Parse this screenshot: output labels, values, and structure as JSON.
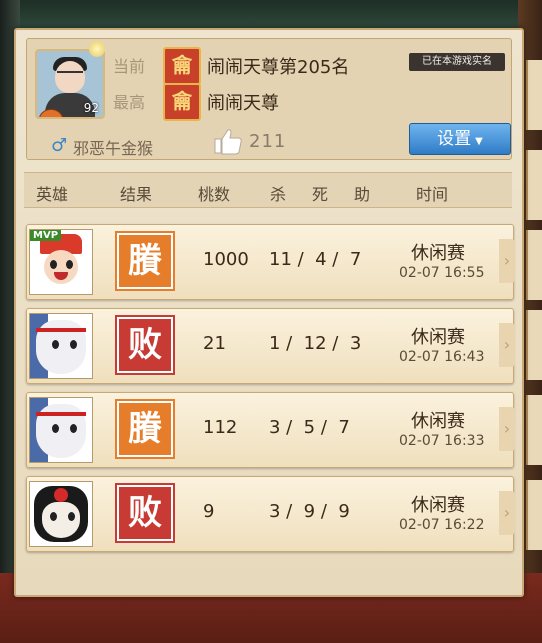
{
  "profile": {
    "level": "92",
    "current_label": "当前",
    "best_label": "最高",
    "rank_icon_glyph": "龠",
    "current_rank": "闹闹天尊第205名",
    "best_rank": "闹闹天尊",
    "realname_badge": "已在本游戏实名",
    "gender_icon": "male-icon",
    "username": "邪恶午金猴",
    "like_icon": "thumb-up-icon",
    "like_count": "211",
    "settings_label": "设置"
  },
  "columns": {
    "hero": "英雄",
    "result": "结果",
    "peach": "桃数",
    "kill": "杀",
    "death": "死",
    "assist": "助",
    "time": "时间"
  },
  "matches": [
    {
      "hero": "red-crown-hero",
      "mvp": "MVP",
      "result": "win",
      "result_glyph": "賸",
      "peach": "1000",
      "kda": "11 /  4 /  7",
      "mode": "休闲赛",
      "time": "02-07 16:55"
    },
    {
      "hero": "white-face-hero",
      "mvp": "",
      "result": "lose",
      "result_glyph": "败",
      "peach": "21",
      "kda": "1 /  12 /  3",
      "mode": "休闲赛",
      "time": "02-07 16:43"
    },
    {
      "hero": "white-face-hero",
      "mvp": "",
      "result": "win",
      "result_glyph": "賸",
      "peach": "112",
      "kda": "3 /  5 /  7",
      "mode": "休闲赛",
      "time": "02-07 16:33"
    },
    {
      "hero": "black-mask-hero",
      "mvp": "",
      "result": "lose",
      "result_glyph": "败",
      "peach": "9",
      "kda": "3 /  9 /  9",
      "mode": "休闲赛",
      "time": "02-07 16:22"
    }
  ],
  "colors": {
    "win": "#e57d2a",
    "lose": "#c83a34",
    "settings_button": "#3c8ad6",
    "panel_bg": "#efe5cf"
  }
}
